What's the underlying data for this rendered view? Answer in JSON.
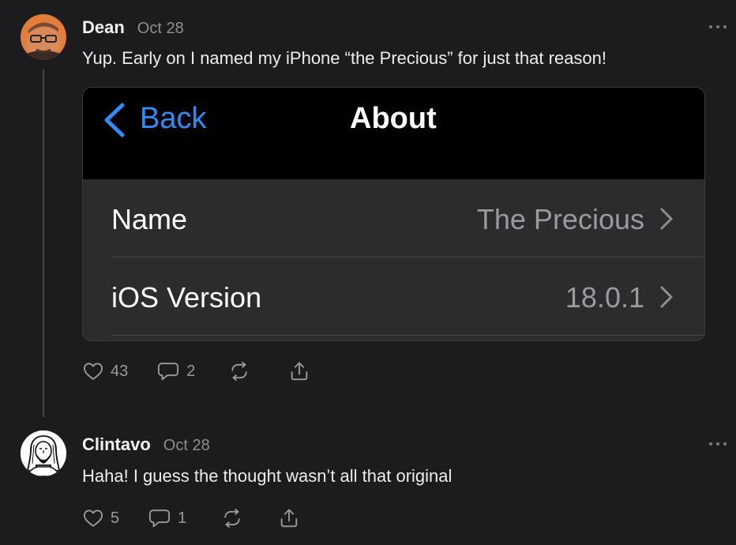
{
  "posts": [
    {
      "author": "Dean",
      "date": "Oct 28",
      "text": "Yup. Early on I named my iPhone “the Precious” for just that reason!",
      "likes": "43",
      "comments": "2",
      "icons": [
        "heart-icon",
        "comment-icon",
        "restack-icon",
        "share-icon",
        "more-icon"
      ]
    },
    {
      "author": "Clintavo",
      "date": "Oct 28",
      "text": "Haha! I guess the thought wasn’t all that original",
      "likes": "5",
      "comments": "1",
      "icons": [
        "heart-icon",
        "comment-icon",
        "restack-icon",
        "share-icon",
        "more-icon"
      ]
    }
  ],
  "embed": {
    "back_label": "Back",
    "title": "About",
    "rows": [
      {
        "label": "Name",
        "value": "The Precious"
      },
      {
        "label": "iOS Version",
        "value": "18.0.1"
      }
    ]
  },
  "colors": {
    "background": "#1c1c1e",
    "ios_blue": "#2f8df6",
    "muted": "#8e8e93"
  }
}
